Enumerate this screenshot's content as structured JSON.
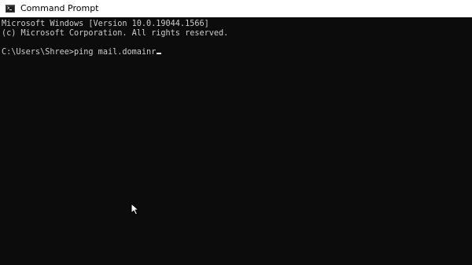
{
  "window": {
    "title": "Command Prompt",
    "icon": "cmd-icon"
  },
  "console": {
    "header_line1": "Microsoft Windows [Version 10.0.19044.1566]",
    "header_line2": "(c) Microsoft Corporation. All rights reserved.",
    "prompt": "C:\\Users\\Shree>",
    "command": "ping mail.domainr",
    "text_color": "#cccccc",
    "background_color": "#0c0c0c"
  },
  "pointer": {
    "icon": "mouse-pointer-icon"
  }
}
